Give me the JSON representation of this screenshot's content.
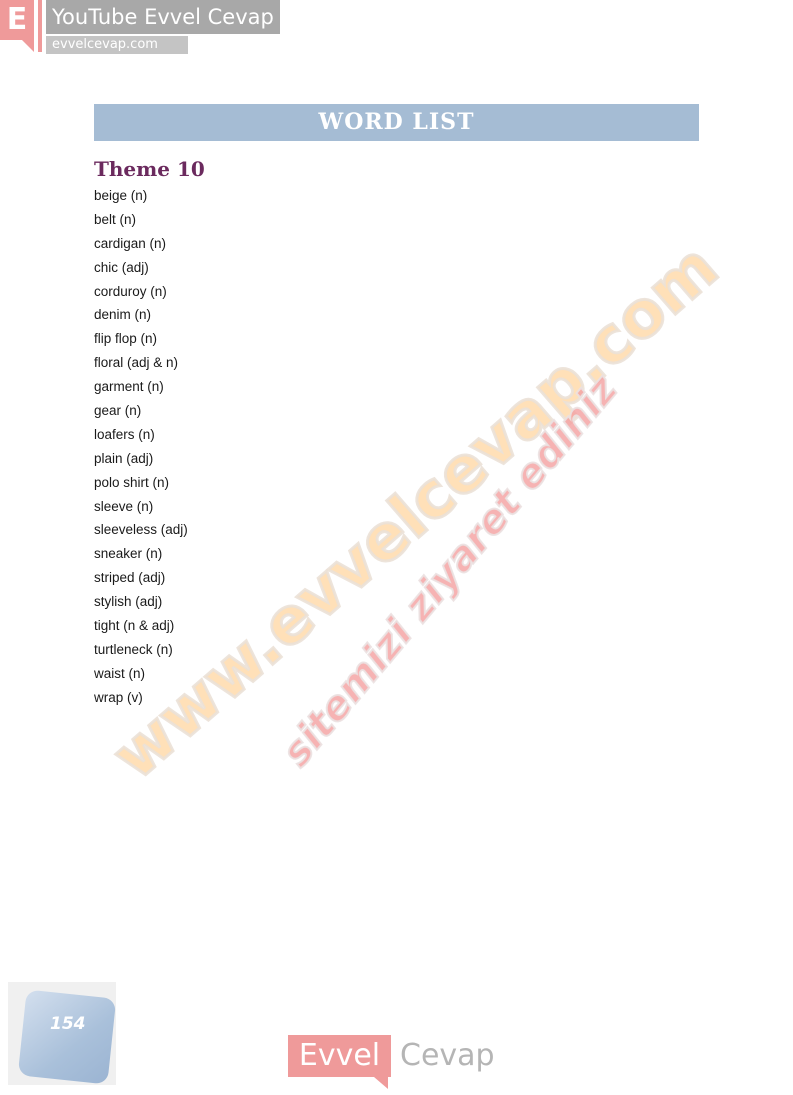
{
  "brand": {
    "letter": "E",
    "title": "YouTube Evvel Cevap",
    "url": "evvelcevap.com"
  },
  "header": {
    "title": "WORD LIST"
  },
  "theme": {
    "title": "Theme 10",
    "words": [
      "beige (n)",
      "belt (n)",
      "cardigan (n)",
      "chic (adj)",
      "corduroy (n)",
      "denim (n)",
      "flip flop (n)",
      "floral (adj & n)",
      "garment (n)",
      "gear (n)",
      "loafers (n)",
      "plain (adj)",
      "polo shirt (n)",
      "sleeve (n)",
      "sleeveless (adj)",
      "sneaker (n)",
      "striped (adj)",
      "stylish (adj)",
      "tight (n & adj)",
      "turtleneck (n)",
      "waist (n)",
      "wrap (v)"
    ]
  },
  "watermark": {
    "main": "www.evvelcevap.com",
    "sub": "sitemizi ziyaret ediniz"
  },
  "page": {
    "number": "154"
  },
  "footer": {
    "brand_left": "Evvel",
    "brand_right": "Cevap"
  },
  "colors": {
    "header_band": "#a5bcd4",
    "theme_title": "#6b2a5e",
    "brand_pink": "#ef9a9a"
  }
}
